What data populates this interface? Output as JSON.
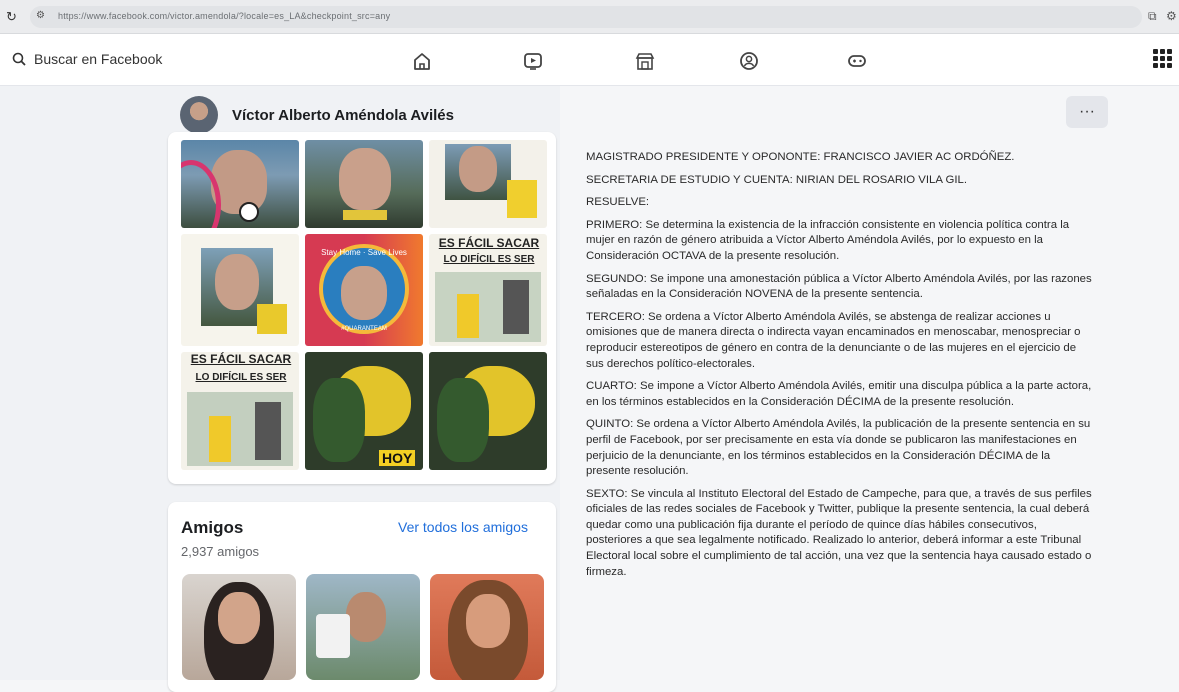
{
  "browser": {
    "url": "https://www.facebook.com/victor.amendola/?locale=es_LA&checkpoint_src=any"
  },
  "topnav": {
    "search_placeholder": "Buscar en Facebook",
    "icons": [
      "home-icon",
      "watch-icon",
      "marketplace-icon",
      "groups-icon",
      "gaming-icon",
      "menu-grid-icon"
    ]
  },
  "profile": {
    "name": "Víctor Alberto Améndola Avilés",
    "more_label": "···"
  },
  "photos": {
    "texts": {
      "sticker1": "ES FÁCIL SACAR",
      "sticker1b": "LO DIFÍCIL ES SER",
      "sticker2": "ES FÁCIL SACAR",
      "sticker2b": "LO DIFÍCIL ES SER",
      "hoy": "HOY",
      "circle_top": "Stay Home · Save Lives",
      "circle_bottom": "#QUARANTEAM"
    }
  },
  "friends": {
    "title": "Amigos",
    "link": "Ver todos los amigos",
    "count": "2,937 amigos"
  },
  "document": {
    "paragraphs": [
      "MAGISTRADO PRESIDENTE Y OPONONTE: FRANCISCO JAVIER AC ORDÓÑEZ.",
      "SECRETARIA DE ESTUDIO Y CUENTA: NIRIAN DEL ROSARIO VILA GIL.",
      "RESUELVE:",
      "PRIMERO: Se determina la existencia de la infracción consistente en violencia política contra la mujer en razón de género atribuida a Víctor Alberto Améndola Avilés, por lo expuesto en la Consideración OCTAVA de la presente resolución.",
      "SEGUNDO: Se impone una amonestación pública a Víctor Alberto Améndola Avilés, por las razones señaladas en la Consideración NOVENA de la presente sentencia.",
      "TERCERO: Se ordena a Víctor Alberto Améndola Avilés, se abstenga de realizar acciones u omisiones que de manera directa o indirecta vayan encaminados en menoscabar, menospreciar o reproducir estereotipos de género en contra de la denunciante o de las mujeres en el ejercicio de sus derechos político-electorales.",
      "CUARTO: Se impone a Víctor Alberto Améndola Avilés, emitir una disculpa pública a la parte actora, en los términos establecidos en la Consideración DÉCIMA de la presente resolución.",
      "QUINTO: Se ordena a Víctor Alberto Améndola Avilés, la publicación de la presente sentencia en su perfil de Facebook, por ser precisamente en esta vía donde se publicaron las manifestaciones en perjuicio de la denunciante, en los términos establecidos en la Consideración DÉCIMA de la presente resolución.",
      "SEXTO: Se vincula al Instituto Electoral del Estado de Campeche, para que, a través de sus perfiles oficiales de las redes sociales de Facebook y Twitter, publique la presente sentencia, la cual deberá quedar como una publicación fija durante el período de quince días hábiles consecutivos, posteriores a que sea legalmente notificado. Realizado lo anterior, deberá informar a este Tribunal Electoral local sobre el cumplimiento de tal acción, una vez que la sentencia haya causado estado o firmeza."
    ]
  }
}
